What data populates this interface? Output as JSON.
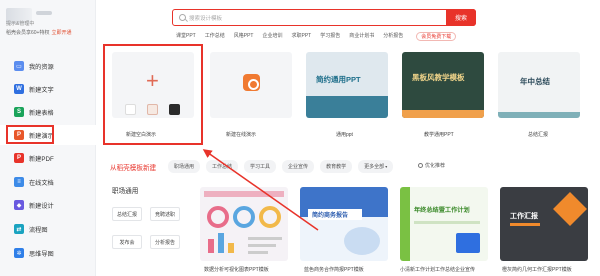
{
  "sidebar": {
    "profile": {
      "line1": "提示&管理中",
      "line2": "稻壳会员享60+特权",
      "vip_link": "立即开通"
    },
    "items": [
      {
        "label": "我的资源",
        "icon": "folder-icon",
        "color": "#5b8def"
      },
      {
        "label": "新建文字",
        "icon": "word-doc-icon",
        "color": "#2f6fe0"
      },
      {
        "label": "新建表格",
        "icon": "sheet-icon",
        "color": "#1aa35a"
      },
      {
        "label": "新建演示",
        "icon": "presentation-icon",
        "color": "#e8572a"
      },
      {
        "label": "新建PDF",
        "icon": "pdf-icon",
        "color": "#e8332a"
      },
      {
        "label": "在线文档",
        "icon": "cloud-doc-icon",
        "color": "#3d8be8"
      },
      {
        "label": "新建设计",
        "icon": "design-icon",
        "color": "#6a5ae0"
      },
      {
        "label": "流程图",
        "icon": "flowchart-icon",
        "color": "#1aa3c0"
      },
      {
        "label": "思维导图",
        "icon": "mindmap-icon",
        "color": "#2f7fe8"
      }
    ]
  },
  "search": {
    "placeholder": "搜索设计模板",
    "button": "搜索"
  },
  "hot_tags": [
    "课堂PPT",
    "工作总结",
    "风格PPT",
    "企业培训",
    "求职PPT",
    "学习报告",
    "商业计划书",
    "分析报告"
  ],
  "promo_tag": "会员免费下载",
  "templates": [
    {
      "label": "新建空白演示"
    },
    {
      "label": "新建在线演示"
    },
    {
      "label": "通用ppt",
      "title": "简约通用PPT"
    },
    {
      "label": "教学通用PPT",
      "title": "黑板风教学模板"
    },
    {
      "label": "总结汇报",
      "title": "年中总结"
    }
  ],
  "section": {
    "title": "从稻壳模板新建",
    "tabs": [
      "职场通用",
      "工作总结",
      "学习工具",
      "企业宣传",
      "教育教学",
      "更多全部"
    ],
    "ranking": "优化推荐"
  },
  "category": {
    "title": "职场通用",
    "buttons": [
      "总结汇报",
      "竞聘述职",
      "发布会",
      "分析报告"
    ]
  },
  "grid": [
    {
      "label": "数据分析可视化图表PPT模板",
      "title": ""
    },
    {
      "label": "蓝色商务合作简报PPT模板",
      "title": "简约商务报告"
    },
    {
      "label": "小清新工作计划工作总结企业宣传",
      "title": "年终总结暨工作计划"
    },
    {
      "label": "橙灰简约几何工作汇报PPT模板",
      "title": "工作汇报"
    }
  ],
  "colors": {
    "accent": "#e8332a",
    "brand_orange": "#e8572a"
  }
}
